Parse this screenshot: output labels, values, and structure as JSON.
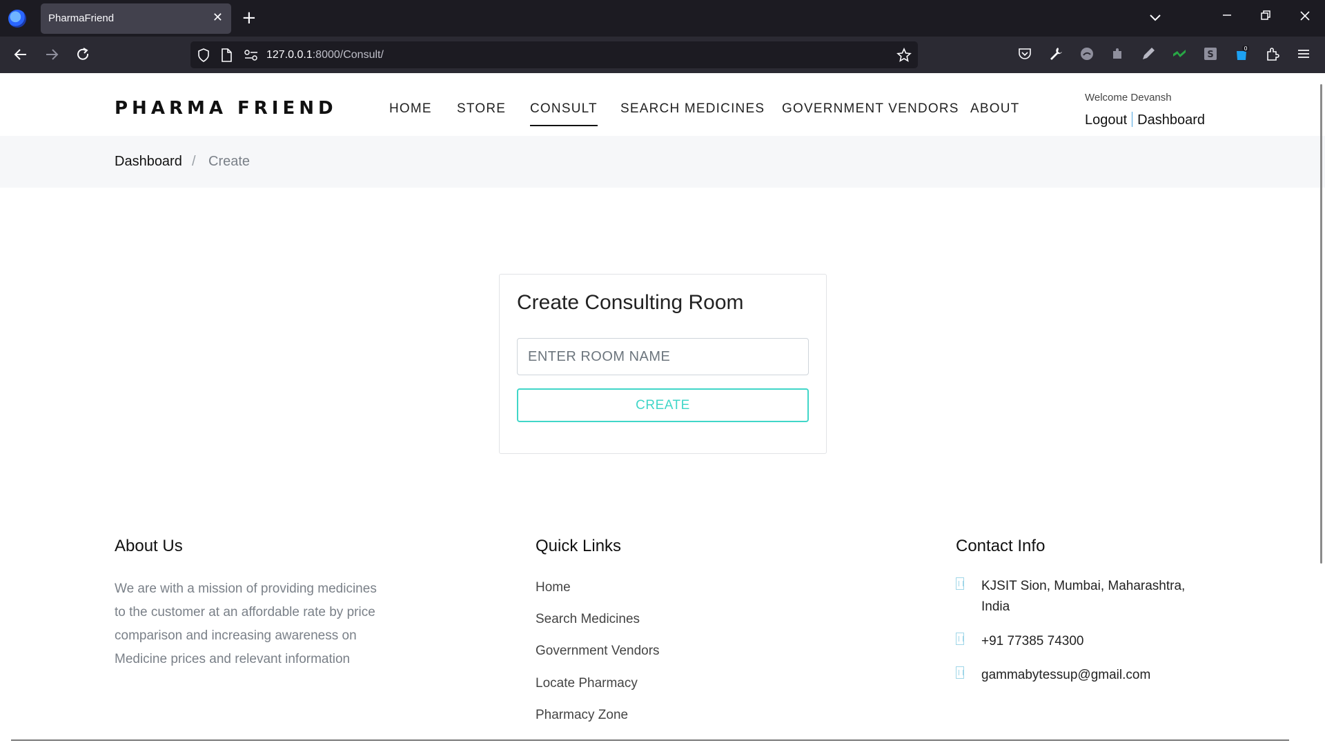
{
  "browser": {
    "tab_title": "PharmaFriend",
    "url_host": "127.0.0.1",
    "url_path": ":8000/Consult/",
    "extension_badge": "0"
  },
  "site": {
    "brand": "PHARMA FRIEND",
    "nav": [
      "HOME",
      "STORE",
      "CONSULT",
      "SEARCH MEDICINES",
      "GOVERNMENT VENDORS",
      "ABOUT"
    ],
    "active_nav": "CONSULT",
    "welcome": "Welcome Devansh",
    "logout": "Logout",
    "dashboard": "Dashboard"
  },
  "breadcrumb": {
    "item1": "Dashboard",
    "separator": "/",
    "item2": "Create"
  },
  "form": {
    "title": "Create Consulting Room",
    "input_placeholder": "ENTER ROOM NAME",
    "input_value": "",
    "button_label": "CREATE",
    "accent_color": "#40d6c8"
  },
  "footer": {
    "about": {
      "heading": "About Us",
      "text": "We are with a mission of providing medicines to the customer at an affordable rate by price comparison and increasing awareness on Medicine prices and relevant information"
    },
    "quick_links": {
      "heading": "Quick Links",
      "items": [
        "Home",
        "Search Medicines",
        "Government Vendors",
        "Locate Pharmacy",
        "Pharmacy Zone"
      ]
    },
    "contact": {
      "heading": "Contact Info",
      "address": "KJSIT Sion, Mumbai, Maharashtra, India",
      "phone": "+91 77385 74300",
      "email": "gammabytessup@gmail.com"
    }
  }
}
